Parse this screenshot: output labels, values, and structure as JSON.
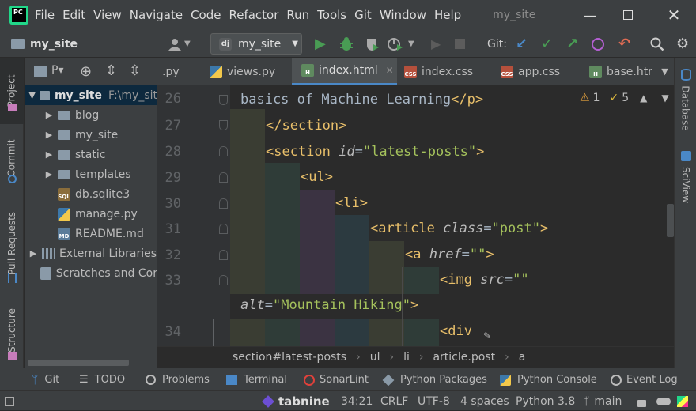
{
  "menubar": {
    "items": [
      "File",
      "Edit",
      "View",
      "Navigate",
      "Code",
      "Refactor",
      "Run",
      "Tools",
      "Git",
      "Window",
      "Help"
    ],
    "window_title": "my_site"
  },
  "toolbar": {
    "project_name": "my_site",
    "run_config": "my_site",
    "git_label": "Git:"
  },
  "left_strip": {
    "tabs": [
      "Project",
      "Commit",
      "Pull Requests",
      "Structure"
    ]
  },
  "right_strip": {
    "tabs": [
      "Database",
      "SciView"
    ]
  },
  "project_panel": {
    "header_label": "P▾",
    "tree": [
      {
        "label": "my_site",
        "extra": "F:\\my_sit",
        "depth": 0,
        "type": "folder",
        "expanded": true,
        "selected": true
      },
      {
        "label": "blog",
        "depth": 1,
        "type": "folder",
        "expanded": false
      },
      {
        "label": "my_site",
        "depth": 1,
        "type": "folder",
        "expanded": false
      },
      {
        "label": "static",
        "depth": 1,
        "type": "folder",
        "expanded": false
      },
      {
        "label": "templates",
        "depth": 1,
        "type": "folder",
        "expanded": false
      },
      {
        "label": "db.sqlite3",
        "depth": 1,
        "type": "sql"
      },
      {
        "label": "manage.py",
        "depth": 1,
        "type": "py"
      },
      {
        "label": "README.md",
        "depth": 1,
        "type": "md"
      },
      {
        "label": "External Libraries",
        "depth": 0,
        "type": "lib"
      },
      {
        "label": "Scratches and Cor",
        "depth": 0,
        "type": "scratch"
      }
    ]
  },
  "tabs": [
    {
      "label": ".py",
      "icon": "none",
      "active": false
    },
    {
      "label": "views.py",
      "icon": "py",
      "active": false
    },
    {
      "label": "index.html",
      "icon": "html",
      "active": true
    },
    {
      "label": "index.css",
      "icon": "css",
      "active": false
    },
    {
      "label": "app.css",
      "icon": "css",
      "active": false
    },
    {
      "label": "base.htr",
      "icon": "html",
      "active": false
    }
  ],
  "inspections": {
    "warnings": "1",
    "weak_warnings": "5"
  },
  "editor": {
    "line_numbers": [
      "26",
      "27",
      "28",
      "29",
      "30",
      "31",
      "32",
      "33",
      "34"
    ],
    "lines": {
      "l26_text": "basics of Machine Learning",
      "l26_close": "</p>",
      "l27_close": "</section>",
      "l28_tag": "<section ",
      "l28_attr": "id",
      "l28_eq": "=",
      "l28_val": "\"latest-posts\"",
      "l28_end": ">",
      "l29": "<ul>",
      "l30": "<li>",
      "l31_tag": "<article ",
      "l31_attr": "class",
      "l31_eq": "=",
      "l31_val": "\"post\"",
      "l31_end": ">",
      "l32_tag": "<a ",
      "l32_attr": "href",
      "l32_eq": "=",
      "l32_val": "\"\"",
      "l32_end": ">",
      "l33_tag": "<img ",
      "l33_attr": "src",
      "l33_eq": "=",
      "l33_val": "\"\"",
      "l33b_attr": "alt",
      "l33b_eq": "=",
      "l33b_val": "\"Mountain Hiking\"",
      "l33b_end": ">",
      "l34": "<div"
    }
  },
  "breadcrumb": [
    "section#latest-posts",
    "ul",
    "li",
    "article.post",
    "a"
  ],
  "tool_windows": [
    "Git",
    "TODO",
    "Problems",
    "Terminal",
    "SonarLint",
    "Python Packages",
    "Python Console",
    "Event Log"
  ],
  "statusbar": {
    "tabnine": "tabnine",
    "position": "34:21",
    "line_sep": "CRLF",
    "encoding": "UTF-8",
    "indent": "4 spaces",
    "interpreter": "Python 3.8",
    "branch": "main"
  },
  "colors": {
    "background": "#2b2b2b",
    "panel": "#3c3f41",
    "tag": "#e8bf6a",
    "value": "#a5c25c",
    "run_green": "#499c54",
    "accent_blue": "#4a88c7"
  }
}
